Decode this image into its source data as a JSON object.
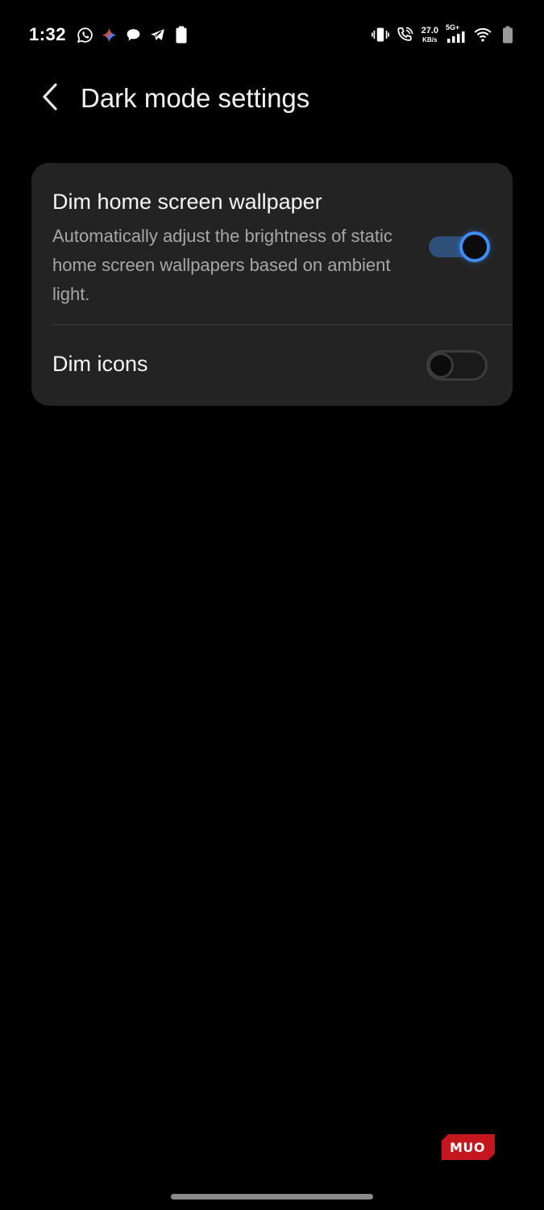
{
  "status_bar": {
    "time": "1:32",
    "network_speed_value": "27.0",
    "network_speed_unit": "KB/s",
    "network_type": "5G+",
    "left_icons": [
      "whatsapp-icon",
      "gemini-icon",
      "chat-icon",
      "telegram-icon",
      "battery-saver-icon"
    ],
    "right_icons": [
      "vibrate-icon",
      "wifi-calling-icon",
      "network-speed",
      "signal-icon",
      "wifi-icon",
      "battery-icon"
    ]
  },
  "header": {
    "title": "Dark mode settings",
    "back_icon": "chevron-left-icon"
  },
  "settings": {
    "items": [
      {
        "title": "Dim home screen wallpaper",
        "description": "Automatically adjust the brightness of static home screen wallpapers based on ambient light.",
        "enabled": true
      },
      {
        "title": "Dim icons",
        "enabled": false
      }
    ]
  },
  "colors": {
    "background": "#000000",
    "card": "#232323",
    "accent": "#3e8df8",
    "description_text": "#a7a7a7"
  },
  "watermark": {
    "text": "MUO",
    "color": "#c4161c"
  }
}
